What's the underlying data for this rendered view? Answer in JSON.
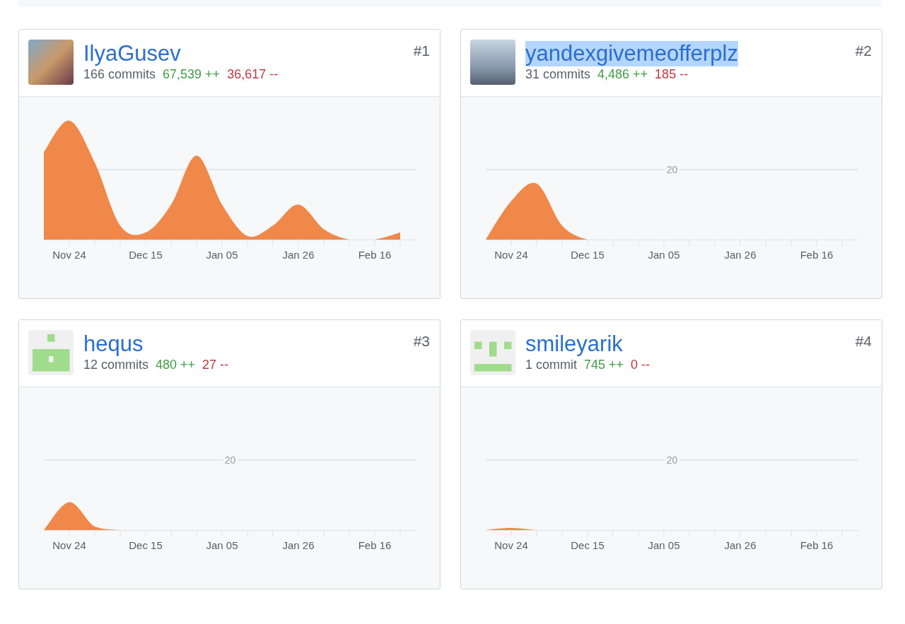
{
  "contributors": [
    {
      "rank": "#1",
      "name": "IlyaGusev",
      "name_selected": false,
      "kind": "photo",
      "commits": "166 commits",
      "additions": "67,539 ++",
      "deletions": "36,617 --",
      "graph": {
        "x_labels": [
          "Nov 24",
          "Dec 15",
          "Jan 05",
          "Jan 26",
          "Feb 16"
        ]
      }
    },
    {
      "rank": "#2",
      "name": "yandexgivemeofferplz",
      "name_selected": true,
      "kind": "photo",
      "commits": "31 commits",
      "additions": "4,486 ++",
      "deletions": "185 --",
      "graph": {
        "grid_label": "20",
        "x_labels": [
          "Nov 24",
          "Dec 15",
          "Jan 05",
          "Jan 26",
          "Feb 16"
        ]
      }
    },
    {
      "rank": "#3",
      "name": "hequs",
      "name_selected": false,
      "kind": "identicon",
      "commits": "12 commits",
      "additions": "480 ++",
      "deletions": "27 --",
      "graph": {
        "grid_label": "20",
        "x_labels": [
          "Nov 24",
          "Dec 15",
          "Jan 05",
          "Jan 26",
          "Feb 16"
        ]
      }
    },
    {
      "rank": "#4",
      "name": "smileyarik",
      "name_selected": false,
      "kind": "identicon",
      "commits": "1 commit",
      "additions": "745 ++",
      "deletions": "0 --",
      "graph": {
        "grid_label": "20",
        "x_labels": [
          "Nov 24",
          "Dec 15",
          "Jan 05",
          "Jan 26",
          "Feb 16"
        ]
      }
    }
  ]
}
